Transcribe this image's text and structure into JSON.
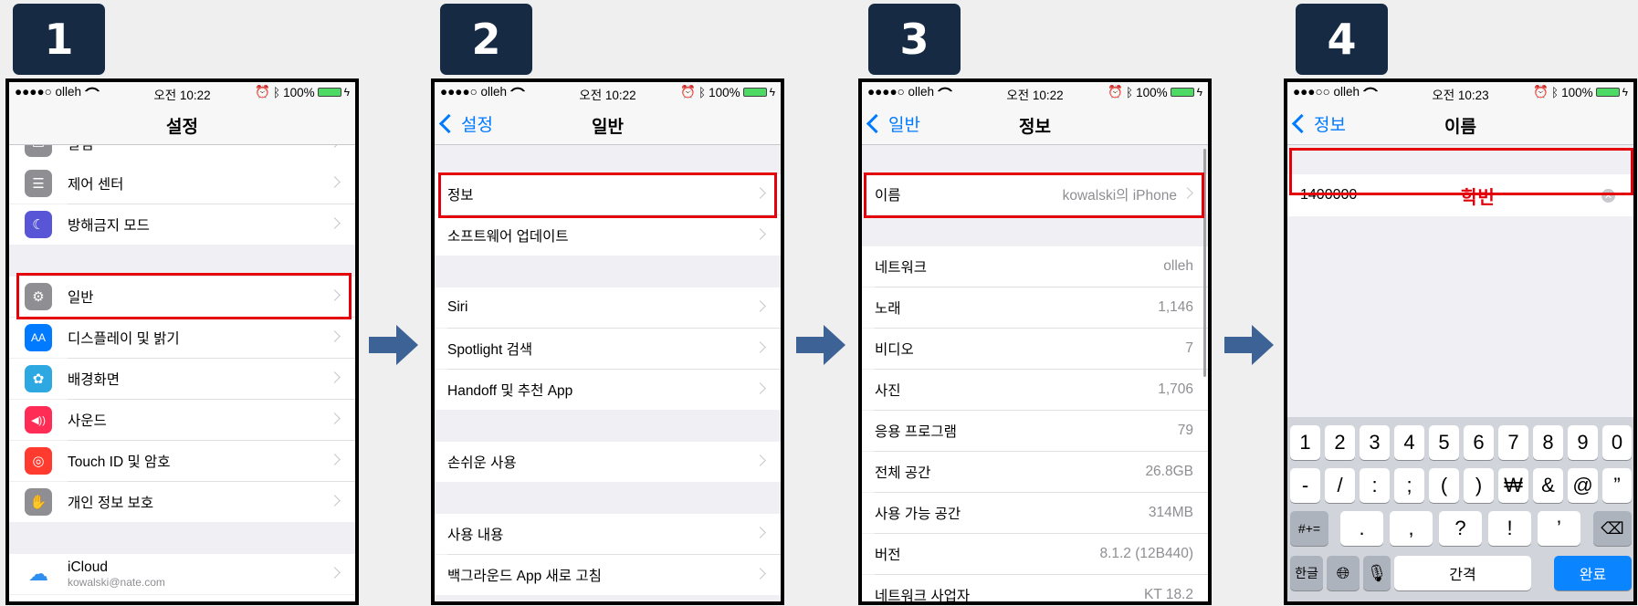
{
  "steps": [
    "1",
    "2",
    "3",
    "4"
  ],
  "status_bars": [
    {
      "carrier": "●●●●○ olleh",
      "time": "오전 10:22",
      "battery": "100%"
    },
    {
      "carrier": "●●●●○ olleh",
      "time": "오전 10:22",
      "battery": "100%"
    },
    {
      "carrier": "●●●●○ olleh",
      "time": "오전 10:22",
      "battery": "100%"
    },
    {
      "carrier": "●●●○○ olleh",
      "time": "오전 10:23",
      "battery": "100%"
    }
  ],
  "phone1": {
    "title": "설정",
    "items": [
      {
        "label": "알림",
        "icon": "notification-icon"
      },
      {
        "label": "제어 센터",
        "icon": "control-center-icon"
      },
      {
        "label": "방해금지 모드",
        "icon": "moon-icon"
      },
      {
        "label": "일반",
        "icon": "gear-icon"
      },
      {
        "label": "디스플레이 및 밝기",
        "icon": "display-brightness-icon"
      },
      {
        "label": "배경화면",
        "icon": "wallpaper-icon"
      },
      {
        "label": "사운드",
        "icon": "speaker-icon"
      },
      {
        "label": "Touch ID 및 암호",
        "icon": "fingerprint-icon"
      },
      {
        "label": "개인 정보 보호",
        "icon": "hand-icon"
      },
      {
        "label": "iCloud",
        "sub": "kowalski@nate.com",
        "icon": "icloud-icon"
      }
    ],
    "icon_glyphs": {
      "display": "AA",
      "speaker": "◀))"
    }
  },
  "phone2": {
    "back": "설정",
    "title": "일반",
    "items": [
      "정보",
      "소프트웨어 업데이트",
      "Siri",
      "Spotlight 검색",
      "Handoff 및 추천 App",
      "손쉬운 사용",
      "사용 내용",
      "백그라운드 App 새로 고침"
    ]
  },
  "phone3": {
    "back": "일반",
    "title": "정보",
    "name_row": {
      "label": "이름",
      "value": "kowalski의 iPhone"
    },
    "rows": [
      {
        "label": "네트워크",
        "value": "olleh"
      },
      {
        "label": "노래",
        "value": "1,146"
      },
      {
        "label": "비디오",
        "value": "7"
      },
      {
        "label": "사진",
        "value": "1,706"
      },
      {
        "label": "응용 프로그램",
        "value": "79"
      },
      {
        "label": "전체 공간",
        "value": "26.8GB"
      },
      {
        "label": "사용 가능 공간",
        "value": "314MB"
      },
      {
        "label": "버전",
        "value": "8.1.2 (12B440)"
      },
      {
        "label": "네트워크 사업자",
        "value": "KT 18.2"
      }
    ]
  },
  "phone4": {
    "back": "정보",
    "title": "이름",
    "field_value": "1400000",
    "annotation": "학번",
    "keyboard": {
      "row1": [
        "1",
        "2",
        "3",
        "4",
        "5",
        "6",
        "7",
        "8",
        "9",
        "0"
      ],
      "row2": [
        "-",
        "/",
        ":",
        ";",
        "(",
        ")",
        "₩",
        "&",
        "@",
        "”"
      ],
      "row3_mode": "#+=",
      "row3": [
        ".",
        ",",
        "?",
        "!",
        "’"
      ],
      "lang": "한글",
      "space": "간격",
      "done": "완료"
    }
  },
  "colors": {
    "accent": "#007aff",
    "highlight": "#e3000b",
    "step_bg": "#172a44",
    "arrow": "#3c6296"
  }
}
